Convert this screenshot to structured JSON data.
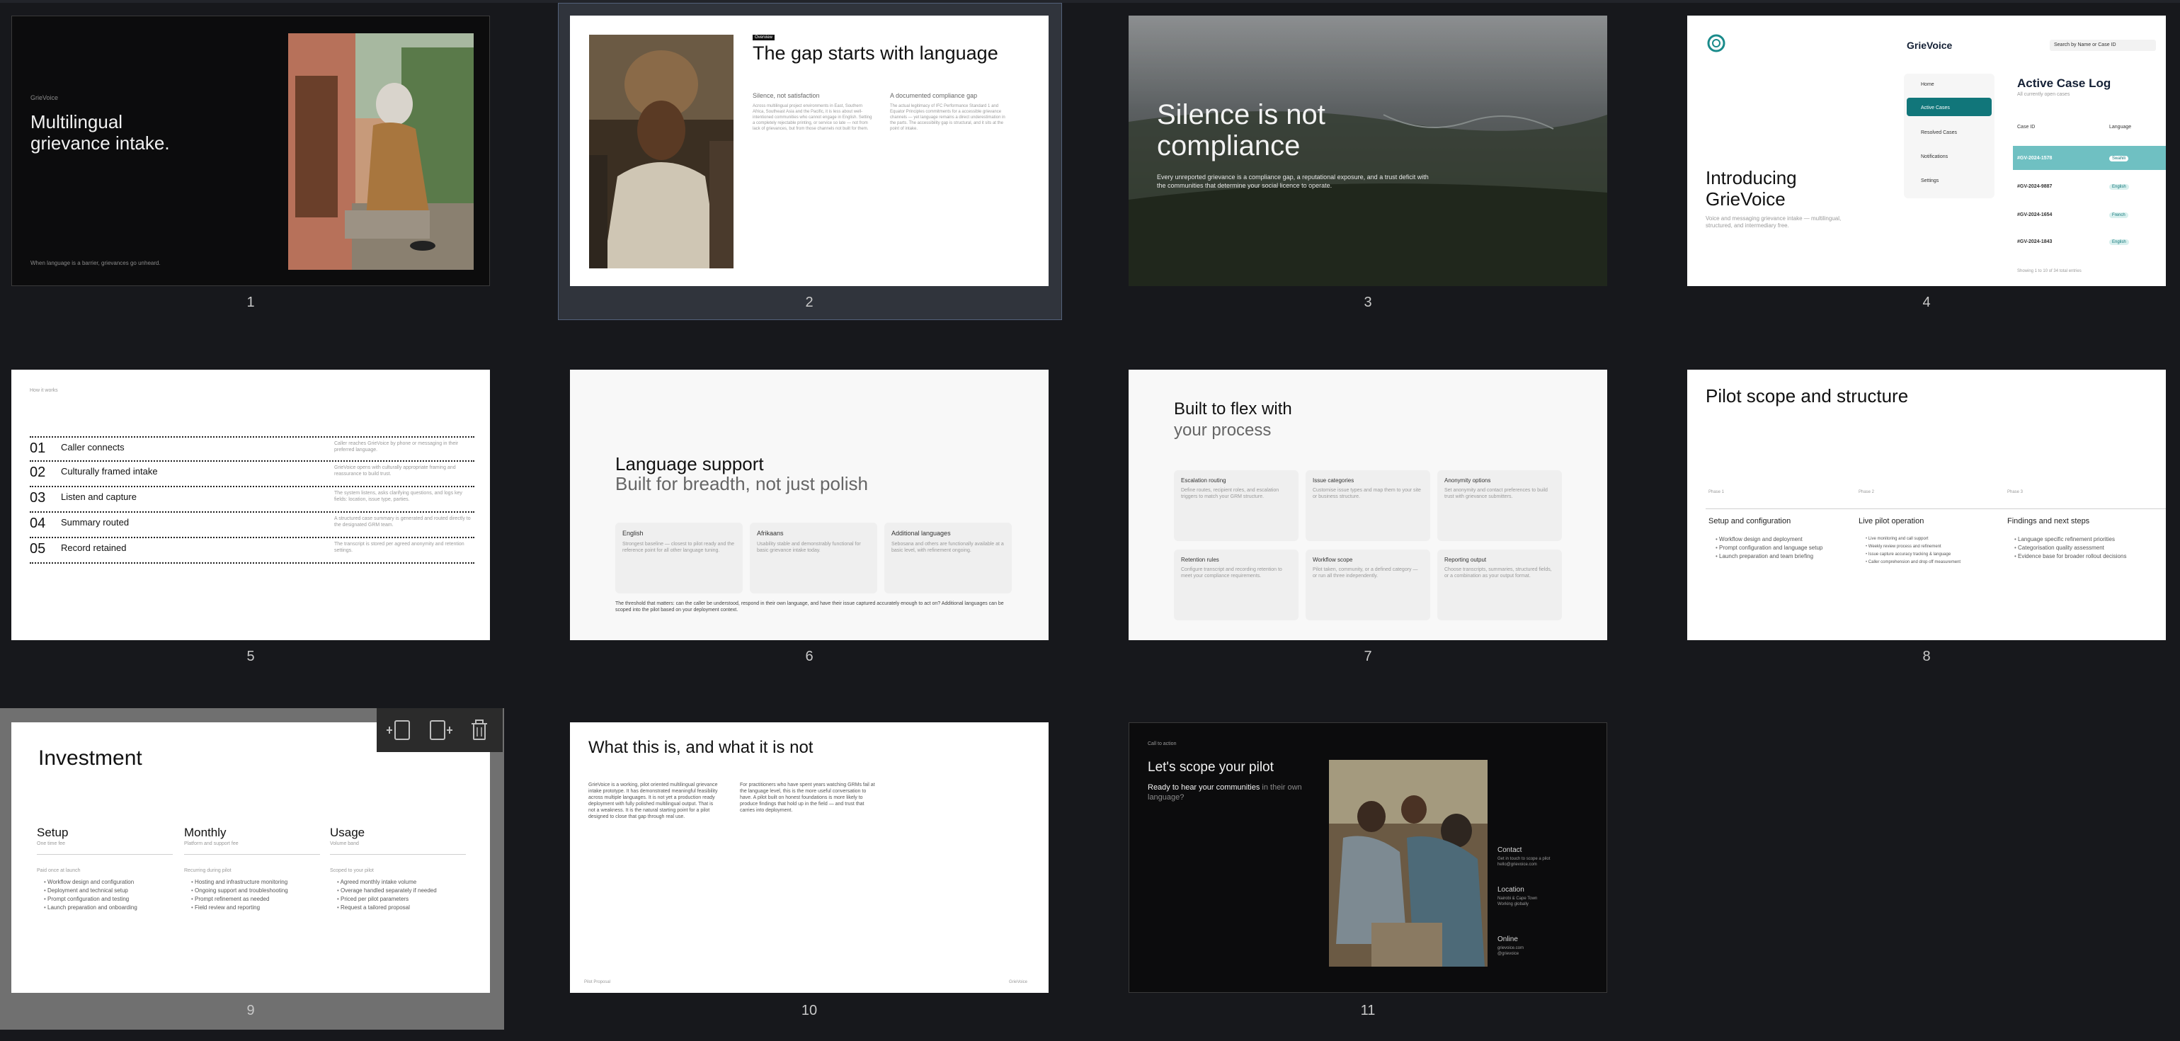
{
  "slides": [
    {
      "number": "1",
      "brand": "GrieVoice",
      "title_line1": "Multilingual",
      "title_line2": "grievance intake.",
      "footer": "When language is a barrier, grievances go unheard."
    },
    {
      "number": "2",
      "tag": "Overview",
      "title": "The gap starts with language",
      "col1_head": "Silence, not satisfaction",
      "col1_body": "Across multilingual project environments in East, Southern Africa, Southeast Asia and the Pacific, it is less about well-intentioned communities who cannot engage in English. Setting a completely rejectable printing, or service so late — not from lack of grievances, but from those channels not built for them.",
      "col2_head": "A documented compliance gap",
      "col2_body": "The actual legitimacy of IFC Performance Standard 1 and Equator Principles commitments for a accessible grievance channels — yet language remains a direct underestimation in the parts. The accessibility gap is structural, and it sits at the point of intake."
    },
    {
      "number": "3",
      "title_line1": "Silence is not",
      "title_line2": "compliance",
      "body": "Every unreported grievance is a compliance gap, a reputational exposure, and a trust deficit with the communities that determine your social licence to operate."
    },
    {
      "number": "4",
      "title_line1": "Introducing",
      "title_line2": "GrieVoice",
      "subtitle": "Voice and messaging grievance intake — multilingual, structured, and intermediary free.",
      "app_name": "GrieVoice",
      "search": "Search by Name or Case ID",
      "nav": [
        "Home",
        "Active Cases",
        "Resolved Cases",
        "Notifications",
        "Settings"
      ],
      "log_title": "Active Case Log",
      "log_sub": "All currently open cases",
      "col_case": "Case ID",
      "col_lang": "Language",
      "rows": [
        {
          "id": "#GV-2024-1578",
          "lang": "Swahili"
        },
        {
          "id": "#GV-2024-9887",
          "lang": "English"
        },
        {
          "id": "#GV-2024-1654",
          "lang": "French"
        },
        {
          "id": "#GV-2024-1843",
          "lang": "English"
        }
      ],
      "footer": "Showing 1 to 10 of 34 total entries"
    },
    {
      "number": "5",
      "header": "How it works",
      "steps": [
        {
          "n": "01",
          "label": "Caller connects",
          "desc": "Caller reaches GrieVoice by phone or messaging in their preferred language."
        },
        {
          "n": "02",
          "label": "Culturally framed intake",
          "desc": "GrieVoice opens with culturally appropriate framing and reassurance to build trust."
        },
        {
          "n": "03",
          "label": "Listen and capture",
          "desc": "The system listens, asks clarifying questions, and logs key fields: location, issue type, parties."
        },
        {
          "n": "04",
          "label": "Summary routed",
          "desc": "A structured case summary is generated and routed directly to the designated GRM team."
        },
        {
          "n": "05",
          "label": "Record retained",
          "desc": "The transcript is stored per agreed anonymity and retention settings."
        }
      ]
    },
    {
      "number": "6",
      "title": "Language support",
      "subtitle": "Built for breadth, not just polish",
      "cards": [
        {
          "h": "English",
          "b": "Strongest baseline — closest to pilot ready and the reference point for all other language tuning."
        },
        {
          "h": "Afrikaans",
          "b": "Usability stable and demonstrably functional for basic grievance intake today."
        },
        {
          "h": "Additional languages",
          "b": "Sebosana and others are functionally available at a basic level, with refinement ongoing."
        }
      ],
      "footer": "The threshold that matters: can the caller be understood, respond in their own language, and have their issue captured accurately enough to act on? Additional languages can be scoped into the pilot based on your deployment context."
    },
    {
      "number": "7",
      "title_line1": "Built to flex with",
      "title_line2": "your process",
      "cards": [
        {
          "h": "Escalation routing",
          "b": "Define routes, recipient roles, and escalation triggers to match your GRM structure."
        },
        {
          "h": "Issue categories",
          "b": "Customise issue types and map them to your site or business structure."
        },
        {
          "h": "Anonymity options",
          "b": "Set anonymity and contact preferences to build trust with grievance submitters."
        },
        {
          "h": "Retention rules",
          "b": "Configure transcript and recording retention to meet your compliance requirements."
        },
        {
          "h": "Workflow scope",
          "b": "Pilot taken, community, or a defined category — or run all three independently."
        },
        {
          "h": "Reporting output",
          "b": "Choose transcripts, summaries, structured fields, or a combination as your output format."
        }
      ]
    },
    {
      "number": "8",
      "title": "Pilot scope and structure",
      "phases": [
        {
          "tag": "Phase 1",
          "h": "Setup and configuration",
          "items": [
            "Workflow design and deployment",
            "Prompt configuration and language setup",
            "Launch preparation and team briefing"
          ]
        },
        {
          "tag": "Phase 2",
          "h": "Live pilot operation",
          "items": [
            "Live monitoring and call support",
            "Weekly review process and refinement",
            "Issue capture accuracy tracking & language",
            "Caller comprehension and drop off measurement"
          ]
        },
        {
          "tag": "Phase 3",
          "h": "Findings and next steps",
          "items": [
            "Language specific refinement priorities",
            "Categorisation quality assessment",
            "Evidence base for broader rollout decisions"
          ]
        }
      ]
    },
    {
      "number": "9",
      "title": "Investment",
      "cols": [
        {
          "h": "Setup",
          "sub": "One time fee",
          "lead": "Paid once at launch",
          "items": [
            "Workflow design and configuration",
            "Deployment and technical setup",
            "Prompt configuration and testing",
            "Launch preparation and onboarding"
          ]
        },
        {
          "h": "Monthly",
          "sub": "Platform and support fee",
          "lead": "Recurring during pilot",
          "items": [
            "Hosting and infrastructure monitoring",
            "Ongoing support and troubleshooting",
            "Prompt refinement as needed",
            "Field review and reporting"
          ]
        },
        {
          "h": "Usage",
          "sub": "Volume band",
          "lead": "Scoped to your pilot",
          "items": [
            "Agreed monthly intake volume",
            "Overage handled separately if needed",
            "Priced per pilot parameters",
            "Request a tailored proposal"
          ]
        }
      ]
    },
    {
      "number": "10",
      "title": "What this is, and what it is not",
      "left": "GrieVoice is a working, pilot oriented multilingual grievance intake prototype. It has demonstrated meaningful feasibility across multiple languages. It is not yet a production ready deployment with fully polished multilingual output. That is not a weakness. It is the natural starting point for a pilot designed to close that gap through real use.",
      "right": "For practitioners who have spent years watching GRMs fail at the language level, this is the more useful conversation to have. A pilot built on honest foundations is more likely to produce findings that hold up in the field — and trust that carries into deployment.",
      "footer_left": "Pilot Proposal",
      "footer_right": "GrieVoice"
    },
    {
      "number": "11",
      "kicker": "Call to action",
      "title": "Let's scope your pilot",
      "lead_white": "Ready to hear your communities",
      "lead_gray": " in their own language?",
      "contacts": [
        {
          "h": "Contact",
          "b": "Get in touch to scope a pilot\nhello@grievoice.com"
        },
        {
          "h": "Location",
          "b": "Nairobi & Cape Town\nWorking globally"
        },
        {
          "h": "Online",
          "b": "grievoice.com\n@grievoice"
        }
      ]
    }
  ],
  "toolbar": {
    "icons": [
      "insert-slide-before-icon",
      "insert-slide-after-icon",
      "delete-slide-icon"
    ]
  }
}
